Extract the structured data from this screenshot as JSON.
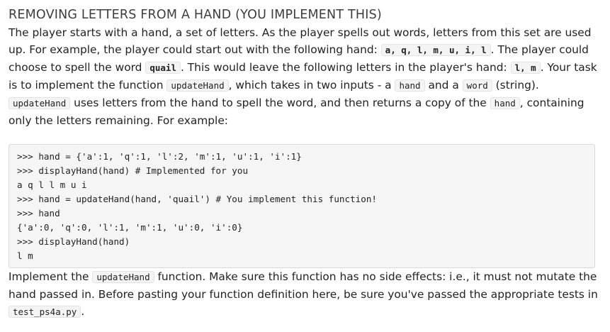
{
  "title": "REMOVING LETTERS FROM A HAND (YOU IMPLEMENT THIS)",
  "intro": {
    "t1": "The player starts with a hand, a set of letters. As the player spells out words, letters from this set are used up. For example, the player could start out with the following hand: ",
    "c1": "a, q, l, m, u, i, l",
    "t2": ". The player could choose to spell the word ",
    "c2": "quail",
    "t3": ". This would leave the following letters in the player's hand: ",
    "c3": "l, m",
    "t4": ". Your task is to implement the function ",
    "c4": "updateHand",
    "t5": ", which takes in two inputs - a ",
    "c5": "hand",
    "t6": " and a ",
    "c6": "word",
    "t7": " (string). ",
    "c7": "updateHand",
    "t8": " uses letters from the hand to spell the word, and then returns a copy of the ",
    "c8": "hand",
    "t9": ", containing only the letters remaining. For example:"
  },
  "code_lines": [
    ">>> hand = {'a':1, 'q':1, 'l':2, 'm':1, 'u':1, 'i':1}",
    ">>> displayHand(hand) # Implemented for you",
    "a q l l m u i",
    ">>> hand = updateHand(hand, 'quail') # You implement this function!",
    ">>> hand",
    "{'a':0, 'q':0, 'l':1, 'm':1, 'u':0, 'i':0}",
    ">>> displayHand(hand)",
    "l m"
  ],
  "outro": {
    "t1": "Implement the ",
    "c1": "updateHand",
    "t2": " function. Make sure this function has no side effects: i.e., it must not mutate the hand passed in. Before pasting your function definition here, be sure you've passed the appropriate tests in ",
    "c2": "test_ps4a.py",
    "t3": "."
  }
}
